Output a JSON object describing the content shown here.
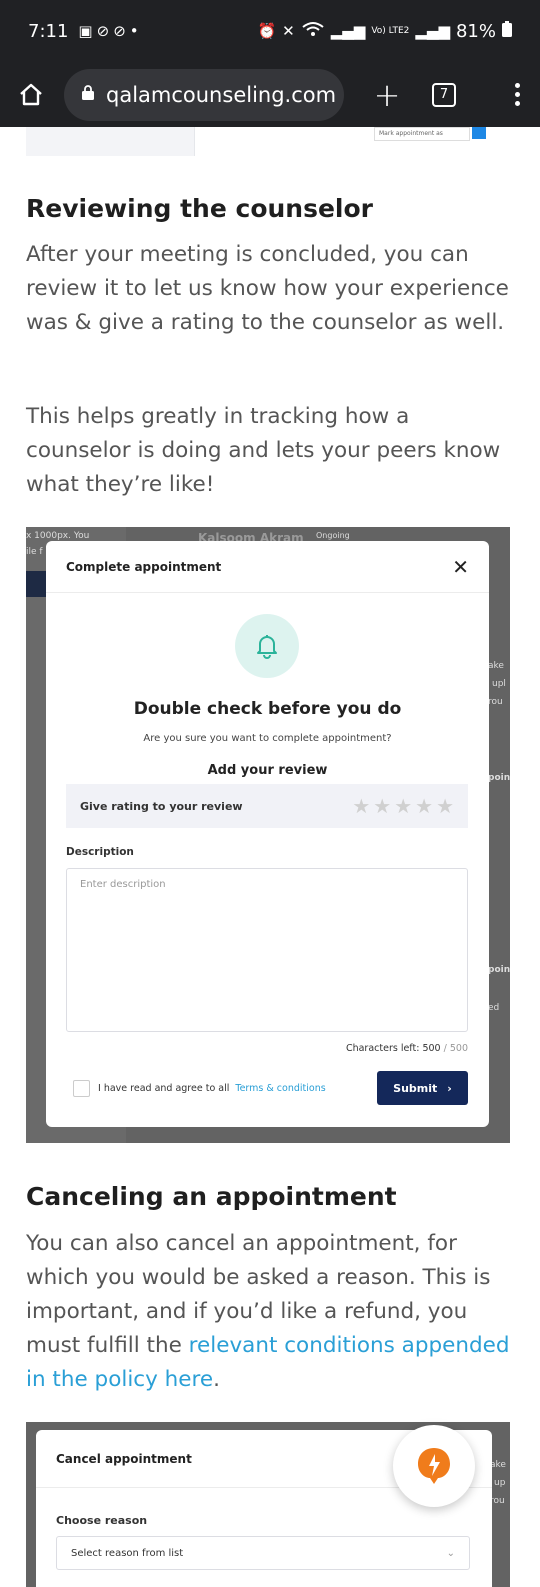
{
  "status_bar": {
    "time": "7:11",
    "battery": "81%",
    "network_label": "Vo) LTE2"
  },
  "browser": {
    "url": "qalamcounseling.com",
    "tab_count": "7"
  },
  "top_screenshot": {
    "dropdown_label": "Mark appointment as"
  },
  "section_review": {
    "heading": "Reviewing the counselor",
    "para1": "After your meeting is concluded, you can review it to let us know how your experience was & give a rating to the counselor as well.",
    "para2": "This helps greatly in tracking how a counselor is doing and lets your peers know what they’re like!"
  },
  "review_screenshot": {
    "bg_fragments": [
      "x 1000px. You",
      "ile f",
      "Kalsoom Akram",
      "Ongoing",
      "ake",
      "upl",
      "rou",
      "point",
      "point",
      "ed"
    ],
    "modal_title": "Complete appointment",
    "headline": "Double check before you do",
    "subtext": "Are you sure you want to complete appointment?",
    "add_review": "Add your review",
    "rating_label": "Give rating to your review",
    "stars_total": 5,
    "stars_filled": 0,
    "description_label": "Description",
    "description_placeholder": "Enter description",
    "chars_label": "Characters left:",
    "chars_left": "500",
    "chars_max": "500",
    "agree_text": "I have read and agree to all",
    "terms_link": "Terms & conditions",
    "submit_label": "Submit"
  },
  "section_cancel": {
    "heading": "Canceling an appointment",
    "para_start": "You can also cancel an appointment, for which you would be asked a reason. This is important, and if you’d like a refund, you must fulfill the",
    "para_link": "relevant conditions appended in the policy here",
    "para_end": "."
  },
  "cancel_screenshot": {
    "bg_fragments": [
      "ake",
      "up",
      "rou"
    ],
    "modal_title": "Cancel appointment",
    "choose_label": "Choose reason",
    "select_placeholder": "Select reason from list"
  },
  "colors": {
    "browser_bar": "#202124",
    "link": "#2a9fd6",
    "submit_bg": "#14285a",
    "bell_bg": "#ddf3ef",
    "bell_stroke": "#2bb39a",
    "fab_icon": "#f07c1b"
  }
}
